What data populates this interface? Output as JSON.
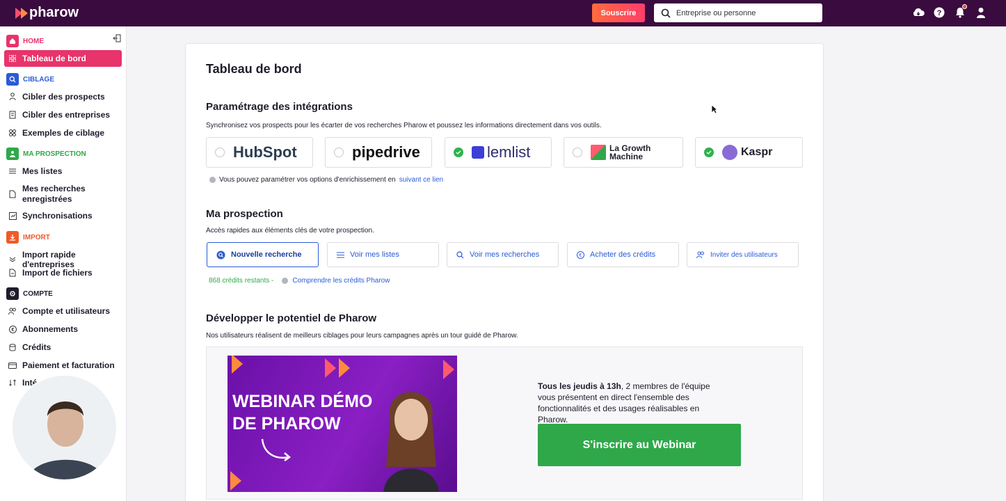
{
  "app": {
    "name": "pharow"
  },
  "topbar": {
    "subscribe_label": "Souscrire",
    "search_placeholder": "Entreprise ou personne"
  },
  "sidebar": {
    "sections": [
      {
        "label": "HOME",
        "color": "#e8336b"
      },
      {
        "label": "CIBLAGE",
        "color": "#2a5bd7"
      },
      {
        "label": "MA PROSPECTION",
        "color": "#2fa84a"
      },
      {
        "label": "IMPORT",
        "color": "#f05a28"
      },
      {
        "label": "COMPTE",
        "color": "#1d1d2b"
      }
    ],
    "items": [
      {
        "label": "Tableau de bord"
      },
      {
        "label": "Cibler des prospects"
      },
      {
        "label": "Cibler des entreprises"
      },
      {
        "label": "Exemples de ciblage"
      },
      {
        "label": "Mes listes"
      },
      {
        "label": "Mes recherches enregistrées"
      },
      {
        "label": "Synchronisations"
      },
      {
        "label": "Import rapide d'entreprises"
      },
      {
        "label": "Import de fichiers"
      },
      {
        "label": "Compte et utilisateurs"
      },
      {
        "label": "Abonnements"
      },
      {
        "label": "Crédits"
      },
      {
        "label": "Paiement et facturation"
      },
      {
        "label": "Inté"
      }
    ]
  },
  "main": {
    "title": "Tableau de bord",
    "integrations": {
      "title": "Paramétrage des intégrations",
      "description": "Synchronisez vos prospects pour les écarter de vos recherches Pharow et poussez les informations directement dans vos outils.",
      "tools": [
        {
          "name": "HubSpot",
          "connected": false
        },
        {
          "name": "pipedrive",
          "connected": false
        },
        {
          "name": "lemlist",
          "connected": true
        },
        {
          "name": "La Growth Machine",
          "connected": false
        },
        {
          "name": "Kaspr",
          "connected": true
        }
      ],
      "info_text": "Vous pouvez paramétrer vos options d'enrichissement en",
      "info_link": "suivant ce lien"
    },
    "prospection": {
      "title": "Ma prospection",
      "description": "Accès rapides aux éléments clés de votre prospection.",
      "actions": [
        {
          "label": "Nouvelle recherche"
        },
        {
          "label": "Voir mes listes"
        },
        {
          "label": "Voir mes recherches"
        },
        {
          "label": "Acheter des crédits"
        },
        {
          "label": "Inviter des utilisateurs"
        }
      ],
      "credits_remaining": "868 crédits restants -",
      "credits_link": "Comprendre les crédits Pharow"
    },
    "develop": {
      "title": "Développer le potentiel de Pharow",
      "description": "Nos utilisateurs réalisent de meilleurs ciblages pour leurs campagnes après un tour guidé de Pharow.",
      "thumbnail_title": "WEBINAR DÉMO DE PHAROW",
      "webinar_bold": "Tous les jeudis à 13h",
      "webinar_text": ", 2 membres de l'équipe vous présentent en direct l'ensemble des fonctionnalités et des usages réalisables en Pharow.",
      "cta_label": "S'inscrire au Webinar"
    }
  }
}
